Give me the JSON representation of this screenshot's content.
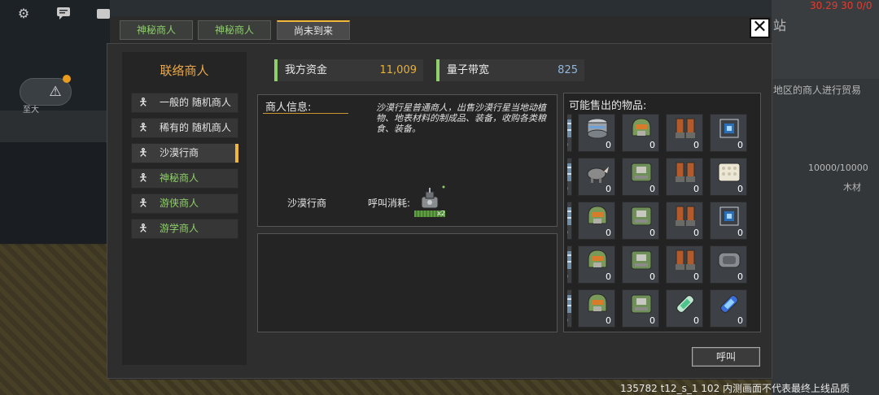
{
  "colors": {
    "accent": "#f0b73a",
    "green_text": "#8fd06a",
    "title_orange": "#e8a84a",
    "funds_value": "#e8b13a",
    "bandwidth_value": "#8fb8e0"
  },
  "tabs": [
    {
      "label": "神秘商人",
      "active": false
    },
    {
      "label": "神秘商人",
      "active": false
    },
    {
      "label": "尚未到来",
      "active": true
    }
  ],
  "close_label": "✕",
  "panel_title": "联络商人",
  "merchants": [
    {
      "label": "一般的 随机商人",
      "style": "white"
    },
    {
      "label": "稀有的 随机商人",
      "style": "white"
    },
    {
      "label": "沙漠行商",
      "style": "white",
      "selected": true
    },
    {
      "label": "神秘商人",
      "style": "green"
    },
    {
      "label": "游侠商人",
      "style": "green"
    },
    {
      "label": "游学商人",
      "style": "green"
    }
  ],
  "resources": {
    "funds": {
      "label": "我方资金",
      "value": "11,009"
    },
    "bandwidth": {
      "label": "量子带宽",
      "value": "825"
    }
  },
  "info": {
    "heading": "商人信息:",
    "description": "沙漠行星普通商人，出售沙漠行星当地动植物、地表材料的制成品、装备，收购各类粮食、装备。",
    "merchant_name": "沙漠行商",
    "call_cost_label": "呼叫消耗:",
    "call_cost_qty": "x2"
  },
  "goods": {
    "title": "可能售出的物品:",
    "rows": [
      [
        "partial",
        "drum",
        "helmet",
        "boots",
        "chip"
      ],
      [
        "partial",
        "rhino",
        "chest",
        "boots",
        "foam"
      ],
      [
        "partial",
        "helmet",
        "chest",
        "boots",
        "chip"
      ],
      [
        "partial",
        "helmet",
        "chest",
        "boots",
        "gear"
      ],
      [
        "partial",
        "helmet",
        "chest",
        "capsule",
        "canister"
      ]
    ],
    "count": "0"
  },
  "call_button_label": "呼叫",
  "background": {
    "top_right_stat": "30.29 30 0/0",
    "right_text_1": "站",
    "right_text_2": "地区的商人进行贸易",
    "right_text_3": "10000/10000",
    "right_text_4": "木材",
    "left_label": "至大",
    "top_icons": [
      "gear-icon",
      "chat-icon",
      "box-icon"
    ]
  },
  "build_tag": "135782 t12_s_1 102  内测画面不代表最终上线品质"
}
